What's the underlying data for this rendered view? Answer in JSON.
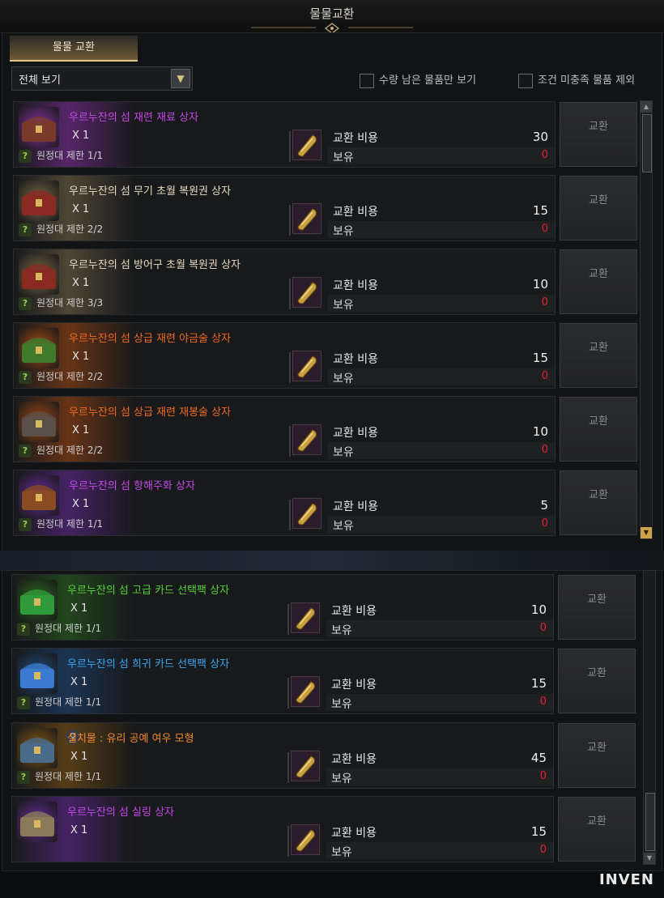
{
  "window": {
    "title": "물물교환"
  },
  "tab": {
    "label": "물물 교환"
  },
  "filter": {
    "selected": "전체 보기",
    "arrow": "▼"
  },
  "options": {
    "only_remaining": "수량 남은 물품만 보기",
    "exclude_unmet": "조건 미충족 물품 제외"
  },
  "labels": {
    "cost": "교환 비용",
    "owned": "보유",
    "exchange": "교환",
    "help": "?"
  },
  "items": [
    {
      "name": "우르누잔의 섬 재련 재료 상자",
      "qty": "X 1",
      "limit": "원정대 제한 1/1",
      "cost": "30",
      "owned": "0",
      "name_color": "#c54ae8",
      "glow": "#8a2fa8",
      "icon": "jewel-chest-icon",
      "icon_color": "#7a3a2a"
    },
    {
      "name": "우르누잔의 섬 무기 초월 복원권 상자",
      "qty": "X 1",
      "limit": "원정대 제한 2/2",
      "cost": "15",
      "owned": "0",
      "name_color": "#e6d9c0",
      "glow": "#7a6a4a",
      "icon": "red-chest-icon",
      "icon_color": "#8a2a22"
    },
    {
      "name": "우르누잔의 섬 방어구 초월 복원권 상자",
      "qty": "X 1",
      "limit": "원정대 제한 3/3",
      "cost": "10",
      "owned": "0",
      "name_color": "#e6d9c0",
      "glow": "#7a6a4a",
      "icon": "red-chest-icon",
      "icon_color": "#8a2a22"
    },
    {
      "name": "우르누잔의 섬 상급 재련 야금술 상자",
      "qty": "X 1",
      "limit": "원정대 제한 2/2",
      "cost": "15",
      "owned": "0",
      "name_color": "#f06a1e",
      "glow": "#a84a12",
      "icon": "green-chest-icon",
      "icon_color": "#3f7a2a"
    },
    {
      "name": "우르누잔의 섬 상급 재련 재봉술 상자",
      "qty": "X 1",
      "limit": "원정대 제한 2/2",
      "cost": "10",
      "owned": "0",
      "name_color": "#f06a1e",
      "glow": "#a84a12",
      "icon": "iron-chest-icon",
      "icon_color": "#5a5048"
    },
    {
      "name": "우르누잔의 섬 항해주화 상자",
      "qty": "X 1",
      "limit": "원정대 제한 1/1",
      "cost": "5",
      "owned": "0",
      "name_color": "#c54ae8",
      "glow": "#6a2aa0",
      "icon": "wood-chest-icon",
      "icon_color": "#8a4a22"
    },
    {
      "name": "우르누잔의 섬 고급 카드 선택팩 상자",
      "qty": "X 1",
      "limit": "원정대 제한 1/1",
      "cost": "10",
      "owned": "0",
      "name_color": "#58d23a",
      "glow": "#2a6a1e",
      "icon": "green-gift-icon",
      "icon_color": "#2f9a3a"
    },
    {
      "name": "우르누잔의 섬 희귀 카드 선택팩 상자",
      "qty": "X 1",
      "limit": "원정대 제한 1/1",
      "cost": "15",
      "owned": "0",
      "name_color": "#3aa6f0",
      "glow": "#1e4a80",
      "icon": "blue-gift-icon",
      "icon_color": "#3a7ad0"
    },
    {
      "name": "설치물 : 유리 공예 여우 모형",
      "qty": "X 1",
      "limit": "원정대 제한 1/1",
      "cost": "45",
      "owned": "0",
      "name_color": "#f08a2a",
      "glow": "#8a5a12",
      "icon": "fox-figure-icon",
      "icon_color": "#4a6a8a"
    },
    {
      "name": "우르누잔의 섬 실링 상자",
      "qty": "X 1",
      "limit": "",
      "cost": "15",
      "owned": "0",
      "name_color": "#c54ae8",
      "glow": "#6a2aa0",
      "icon": "silver-chest-icon",
      "icon_color": "#8a7a5a"
    }
  ],
  "watermark": "INVEN"
}
